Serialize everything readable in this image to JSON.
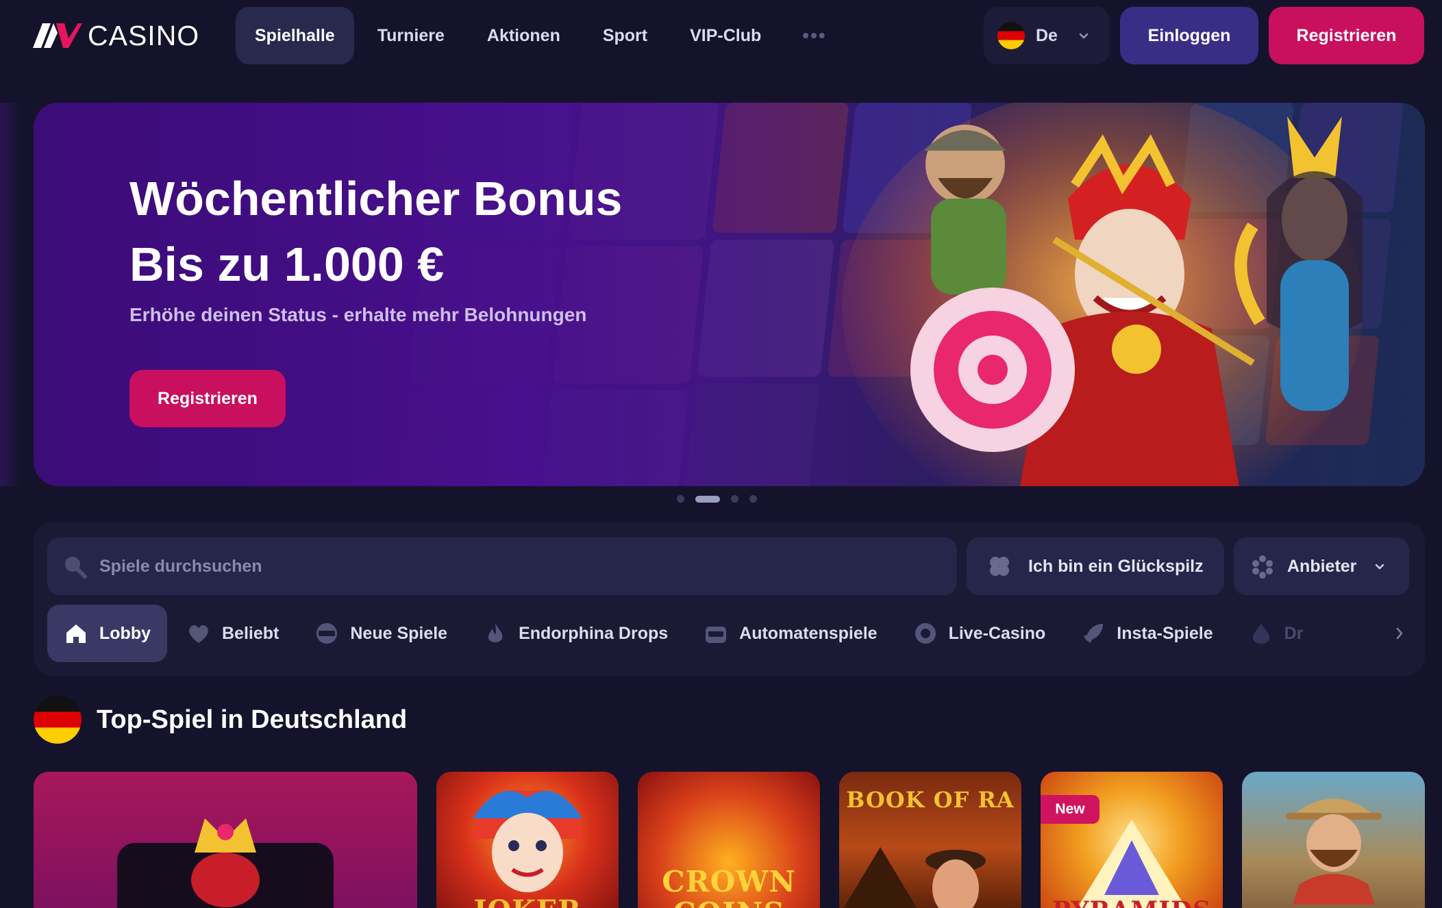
{
  "header": {
    "logo_text": "CASINO",
    "nav": [
      {
        "label": "Spielhalle",
        "active": true
      },
      {
        "label": "Turniere",
        "active": false
      },
      {
        "label": "Aktionen",
        "active": false
      },
      {
        "label": "Sport",
        "active": false
      },
      {
        "label": "VIP-Club",
        "active": false
      }
    ],
    "more_icon": "ellipsis-icon",
    "language": {
      "label": "De",
      "flag": "germany-flag-icon"
    },
    "login_label": "Einloggen",
    "register_label": "Registrieren"
  },
  "hero": {
    "title_line1": "Wöchentlicher Bonus",
    "title_line2": "Bis zu 1.000 €",
    "subtitle": "Erhöhe deinen Status - erhalte mehr Belohnungen",
    "cta_label": "Registrieren",
    "slides": 4,
    "active_slide": 2
  },
  "filters": {
    "search_placeholder": "Spiele durchsuchen",
    "lucky_label": "Ich bin ein Glückspilz",
    "provider_label": "Anbieter",
    "categories": [
      {
        "label": "Lobby",
        "icon": "home-icon",
        "active": true
      },
      {
        "label": "Beliebt",
        "icon": "heart-icon",
        "active": false
      },
      {
        "label": "Neue Spiele",
        "icon": "new-badge-icon",
        "active": false
      },
      {
        "label": "Endorphina Drops",
        "icon": "flame-icon",
        "active": false
      },
      {
        "label": "Automatenspiele",
        "icon": "slot-machine-icon",
        "active": false
      },
      {
        "label": "Live-Casino",
        "icon": "chip-icon",
        "active": false
      },
      {
        "label": "Insta-Spiele",
        "icon": "rocket-icon",
        "active": false
      },
      {
        "label": "Dr",
        "icon": "drops-icon",
        "active": false
      }
    ]
  },
  "section": {
    "title": "Top-Spiel in Deutschland",
    "flag": "germany-flag-icon"
  },
  "games": [
    {
      "title": "",
      "badge": ""
    },
    {
      "title": "JOKER",
      "badge": ""
    },
    {
      "title": "CROWN COINS",
      "badge": ""
    },
    {
      "title": "BOOK OF RA",
      "badge": ""
    },
    {
      "title": "PYRAMIDS",
      "badge": "New"
    },
    {
      "title": "",
      "badge": ""
    }
  ],
  "colors": {
    "background": "#14132b",
    "accent_pink": "#c8105e",
    "login_purple": "#3a2d86",
    "panel": "#1b1a35"
  }
}
